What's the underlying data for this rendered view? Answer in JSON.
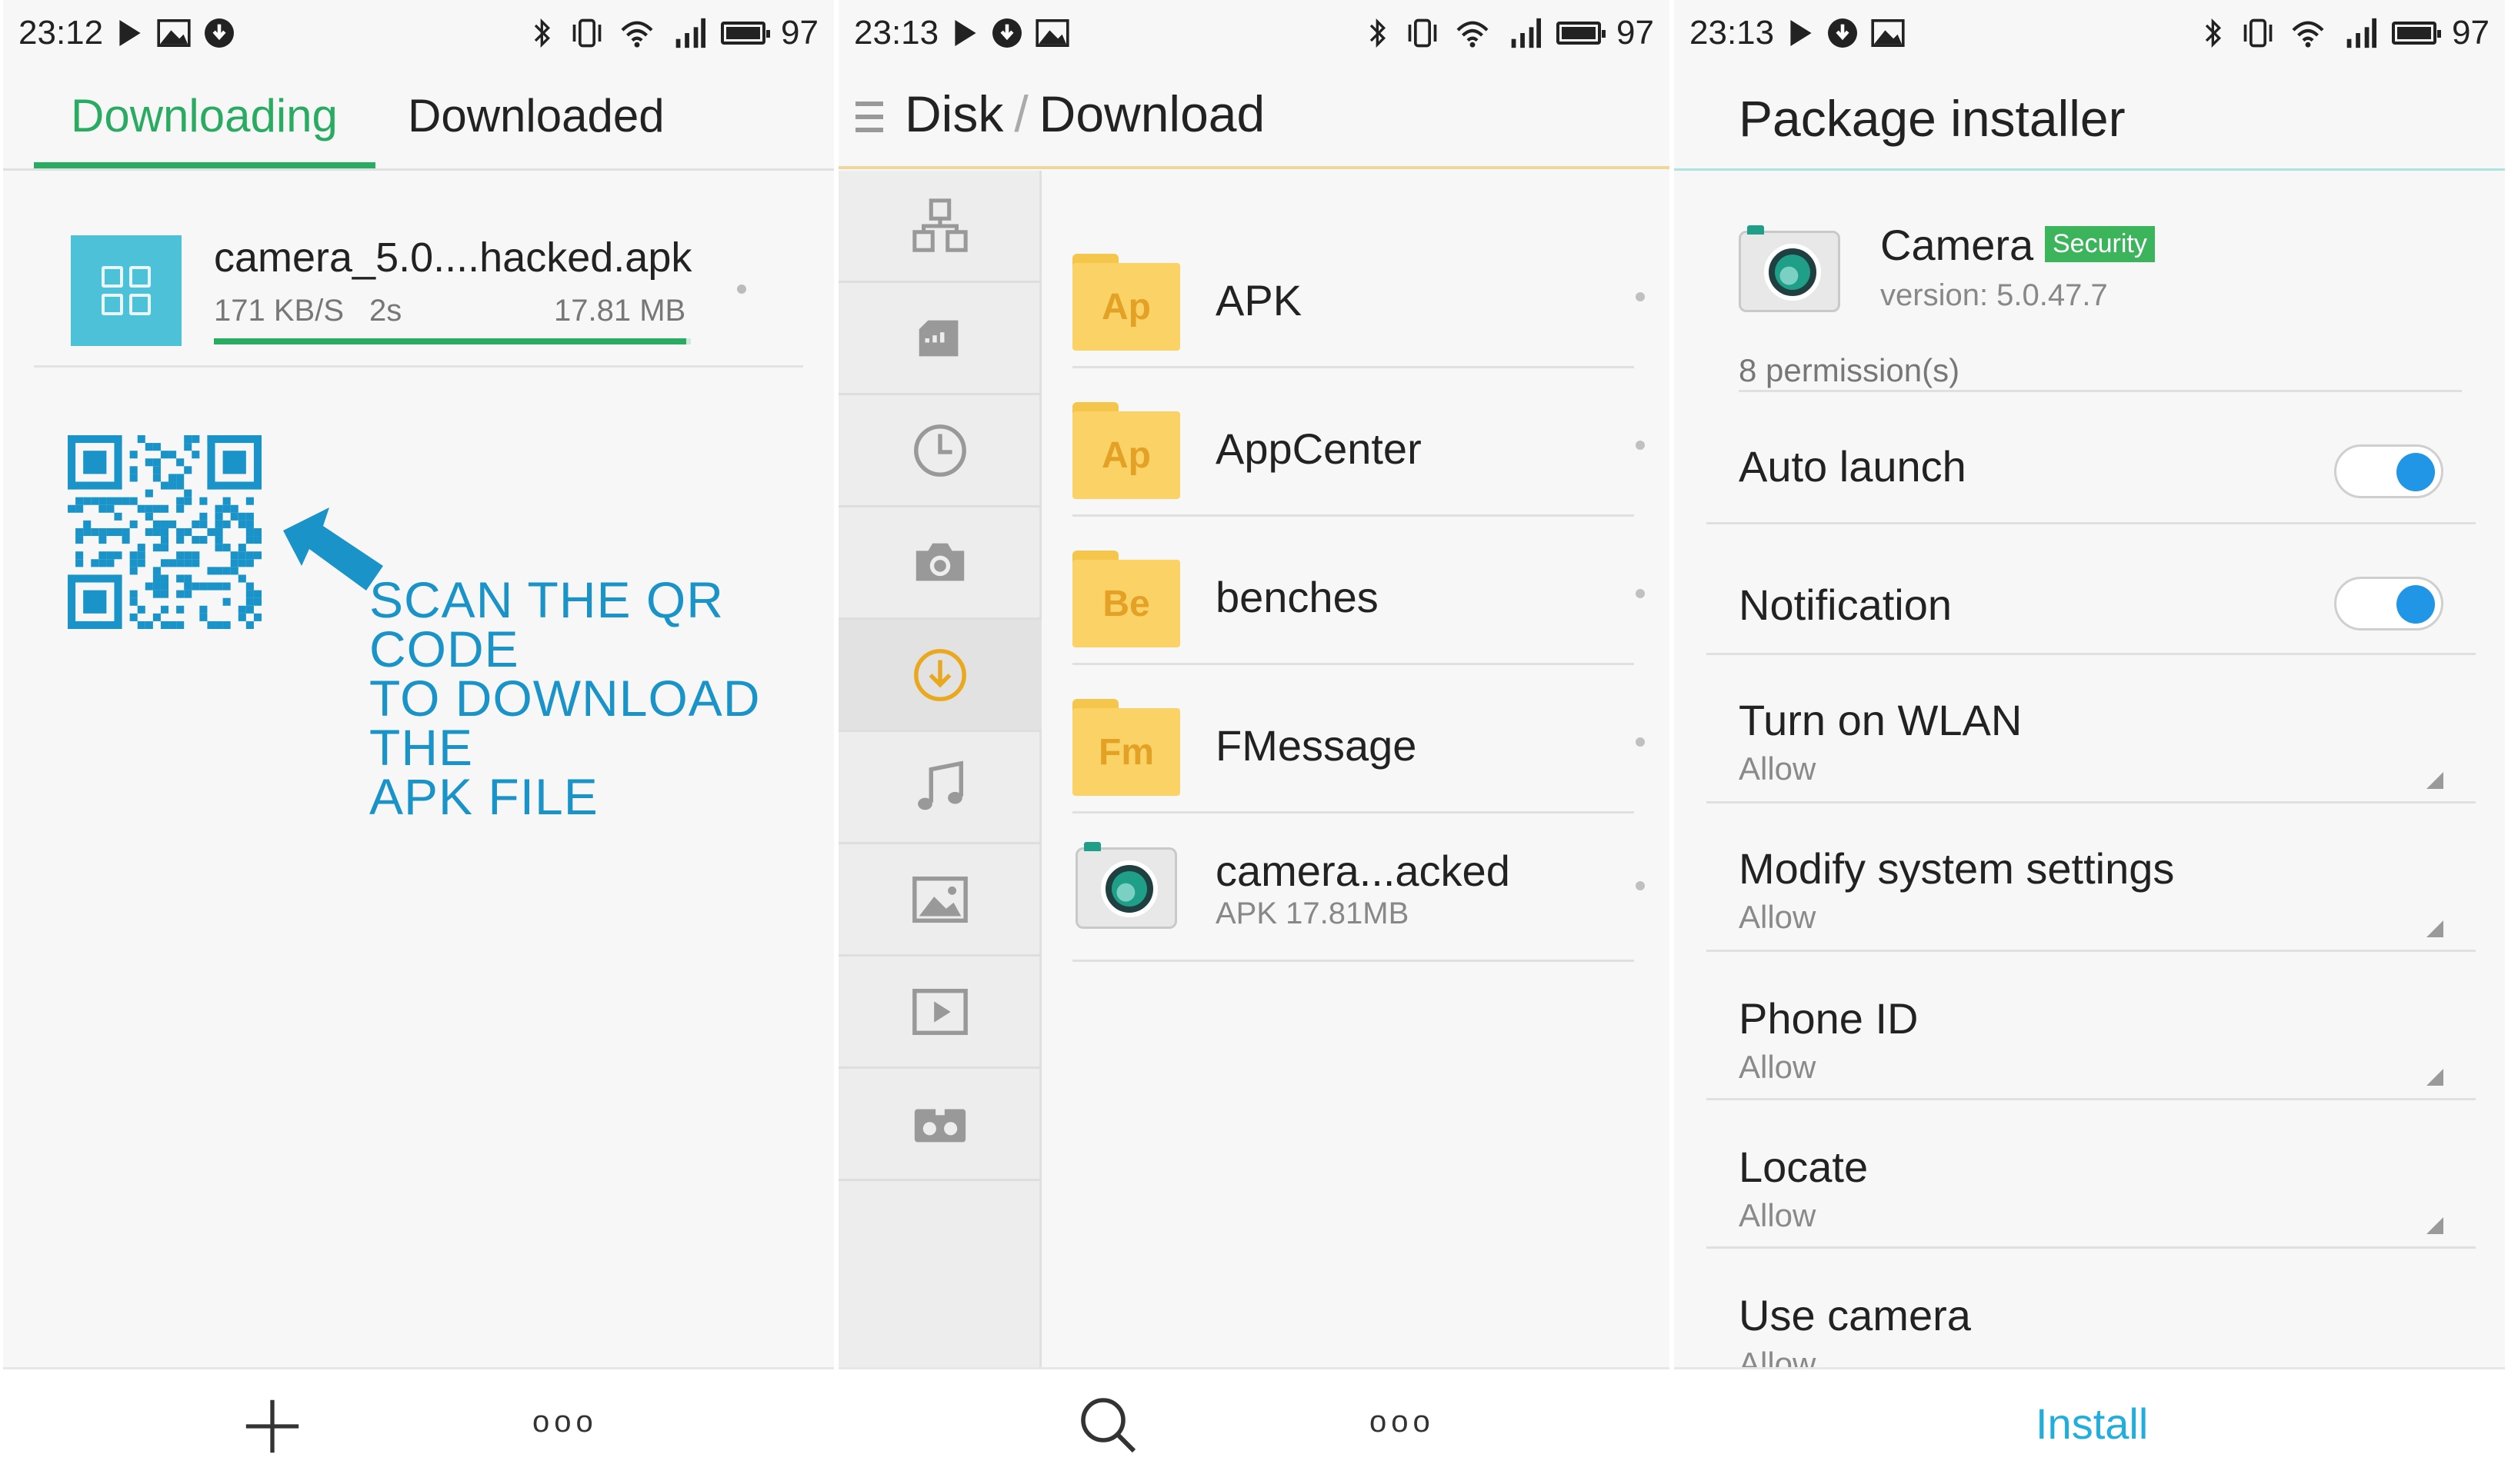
{
  "panel1": {
    "status": {
      "time": "23:12",
      "battery": "97"
    },
    "tabs": {
      "downloading": "Downloading",
      "downloaded": "Downloaded"
    },
    "download": {
      "filename": "camera_5.0....hacked.apk",
      "speed": "171 KB/S",
      "remaining": "2s",
      "size": "17.81 MB",
      "progress": 0.99
    },
    "scan_text": [
      "SCAN THE QR CODE",
      "TO DOWNLOAD THE",
      "APK FILE"
    ],
    "bottom": {
      "add_icon": "plus-icon",
      "more_label": "ooo"
    }
  },
  "panel2": {
    "status": {
      "time": "23:13",
      "battery": "97"
    },
    "breadcrumb": {
      "root": "Disk",
      "separator": "/",
      "current": "Download"
    },
    "nav_icons": [
      "categories-icon",
      "sd-card-icon",
      "recent-clock-icon",
      "camera-icon",
      "download-icon",
      "music-icon",
      "image-icon",
      "video-icon",
      "vr-glasses-icon"
    ],
    "files": [
      {
        "badge": "Ap",
        "name": "APK"
      },
      {
        "badge": "Ap",
        "name": "AppCenter"
      },
      {
        "badge": "Be",
        "name": "benches"
      },
      {
        "badge": "Fm",
        "name": "FMessage"
      }
    ],
    "apk_file": {
      "name": "camera...acked",
      "meta": "APK 17.81MB"
    },
    "bottom": {
      "search_icon": "search-icon",
      "more_label": "ooo"
    }
  },
  "panel3": {
    "status": {
      "time": "23:13",
      "battery": "97"
    },
    "title": "Package installer",
    "app": {
      "name": "Camera",
      "badge": "Security",
      "version": "version: 5.0.47.7"
    },
    "permission_count": "8 permission(s)",
    "toggles": [
      {
        "label": "Auto launch",
        "on": true
      },
      {
        "label": "Notification",
        "on": true
      }
    ],
    "permissions": [
      {
        "label": "Turn on WLAN",
        "value": "Allow"
      },
      {
        "label": "Modify system settings",
        "value": "Allow"
      },
      {
        "label": "Phone ID",
        "value": "Allow"
      },
      {
        "label": "Locate",
        "value": "Allow"
      },
      {
        "label": "Use camera",
        "value": "Allow"
      }
    ],
    "install_label": "Install",
    "accent_color": "#22aedc"
  }
}
